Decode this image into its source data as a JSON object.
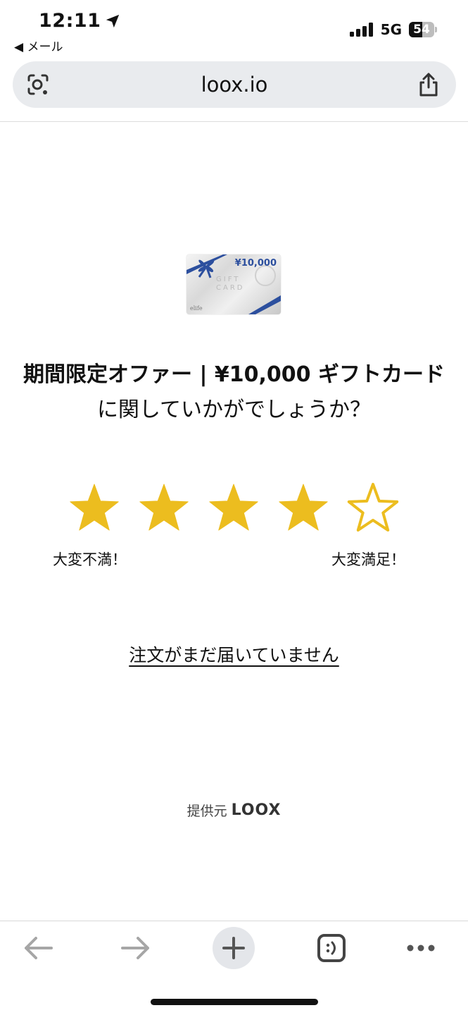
{
  "status": {
    "time": "12:11",
    "back_label": "◀ メール",
    "network": "5G",
    "battery_level": "54",
    "battery_percent": 54
  },
  "browser": {
    "url": "loox.io"
  },
  "review": {
    "card_amount": "¥10,000",
    "card_word_gift": "GIFT",
    "card_word_card": "CARD",
    "card_brand": "elife",
    "question_product": "期間限定オファー | ¥10,000 ギフトカード",
    "question_suffix": " に関していかがでしょうか？",
    "stars_selected": 4,
    "stars_total": 5,
    "label_low": "大変不満！",
    "label_high": "大変満足！",
    "not_arrived_link": "注文がまだ届いていません",
    "powered_by_prefix": "提供元",
    "powered_by_brand": "LOOX"
  },
  "colors": {
    "star": "#ecbd1f",
    "accent_blue": "#2c4f9e",
    "toolbar_icon": "#a6a6a6"
  },
  "icons": {
    "lens": "lens-icon",
    "share": "share-icon",
    "back": "arrow-left-icon",
    "forward": "arrow-right-icon",
    "new_tab": "plus-icon",
    "tabs": "tabs-icon",
    "more": "more-icon"
  }
}
